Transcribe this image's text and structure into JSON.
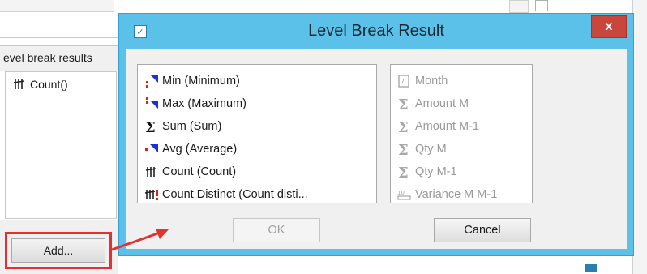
{
  "background": {
    "left_panel_header": "evel break results",
    "list_items": [
      {
        "icon": "count-icon",
        "label": "Count()"
      }
    ],
    "add_button_label": "Add..."
  },
  "dialog": {
    "title": "Level Break Result",
    "close_label": "x",
    "functions": [
      {
        "icon": "min-icon",
        "label": "Min (Minimum)"
      },
      {
        "icon": "max-icon",
        "label": "Max (Maximum)"
      },
      {
        "icon": "sum-icon",
        "label": "Sum (Sum)"
      },
      {
        "icon": "avg-icon",
        "label": "Avg (Average)"
      },
      {
        "icon": "count-icon",
        "label": "Count (Count)"
      },
      {
        "icon": "count-distinct-icon",
        "label": "Count Distinct (Count disti..."
      }
    ],
    "fields": [
      {
        "icon": "date-field-icon",
        "label": "Month"
      },
      {
        "icon": "sum-icon",
        "label": "Amount M"
      },
      {
        "icon": "sum-icon",
        "label": "Amount M-1"
      },
      {
        "icon": "sum-icon",
        "label": "Qty M"
      },
      {
        "icon": "sum-icon",
        "label": "Qty M-1"
      },
      {
        "icon": "numeric-field-icon",
        "label": "Variance M M-1"
      }
    ],
    "ok_label": "OK",
    "cancel_label": "Cancel"
  },
  "colors": {
    "dialog_frame": "#5cc1e8",
    "close_button": "#c9463d",
    "highlight": "#e53030"
  }
}
